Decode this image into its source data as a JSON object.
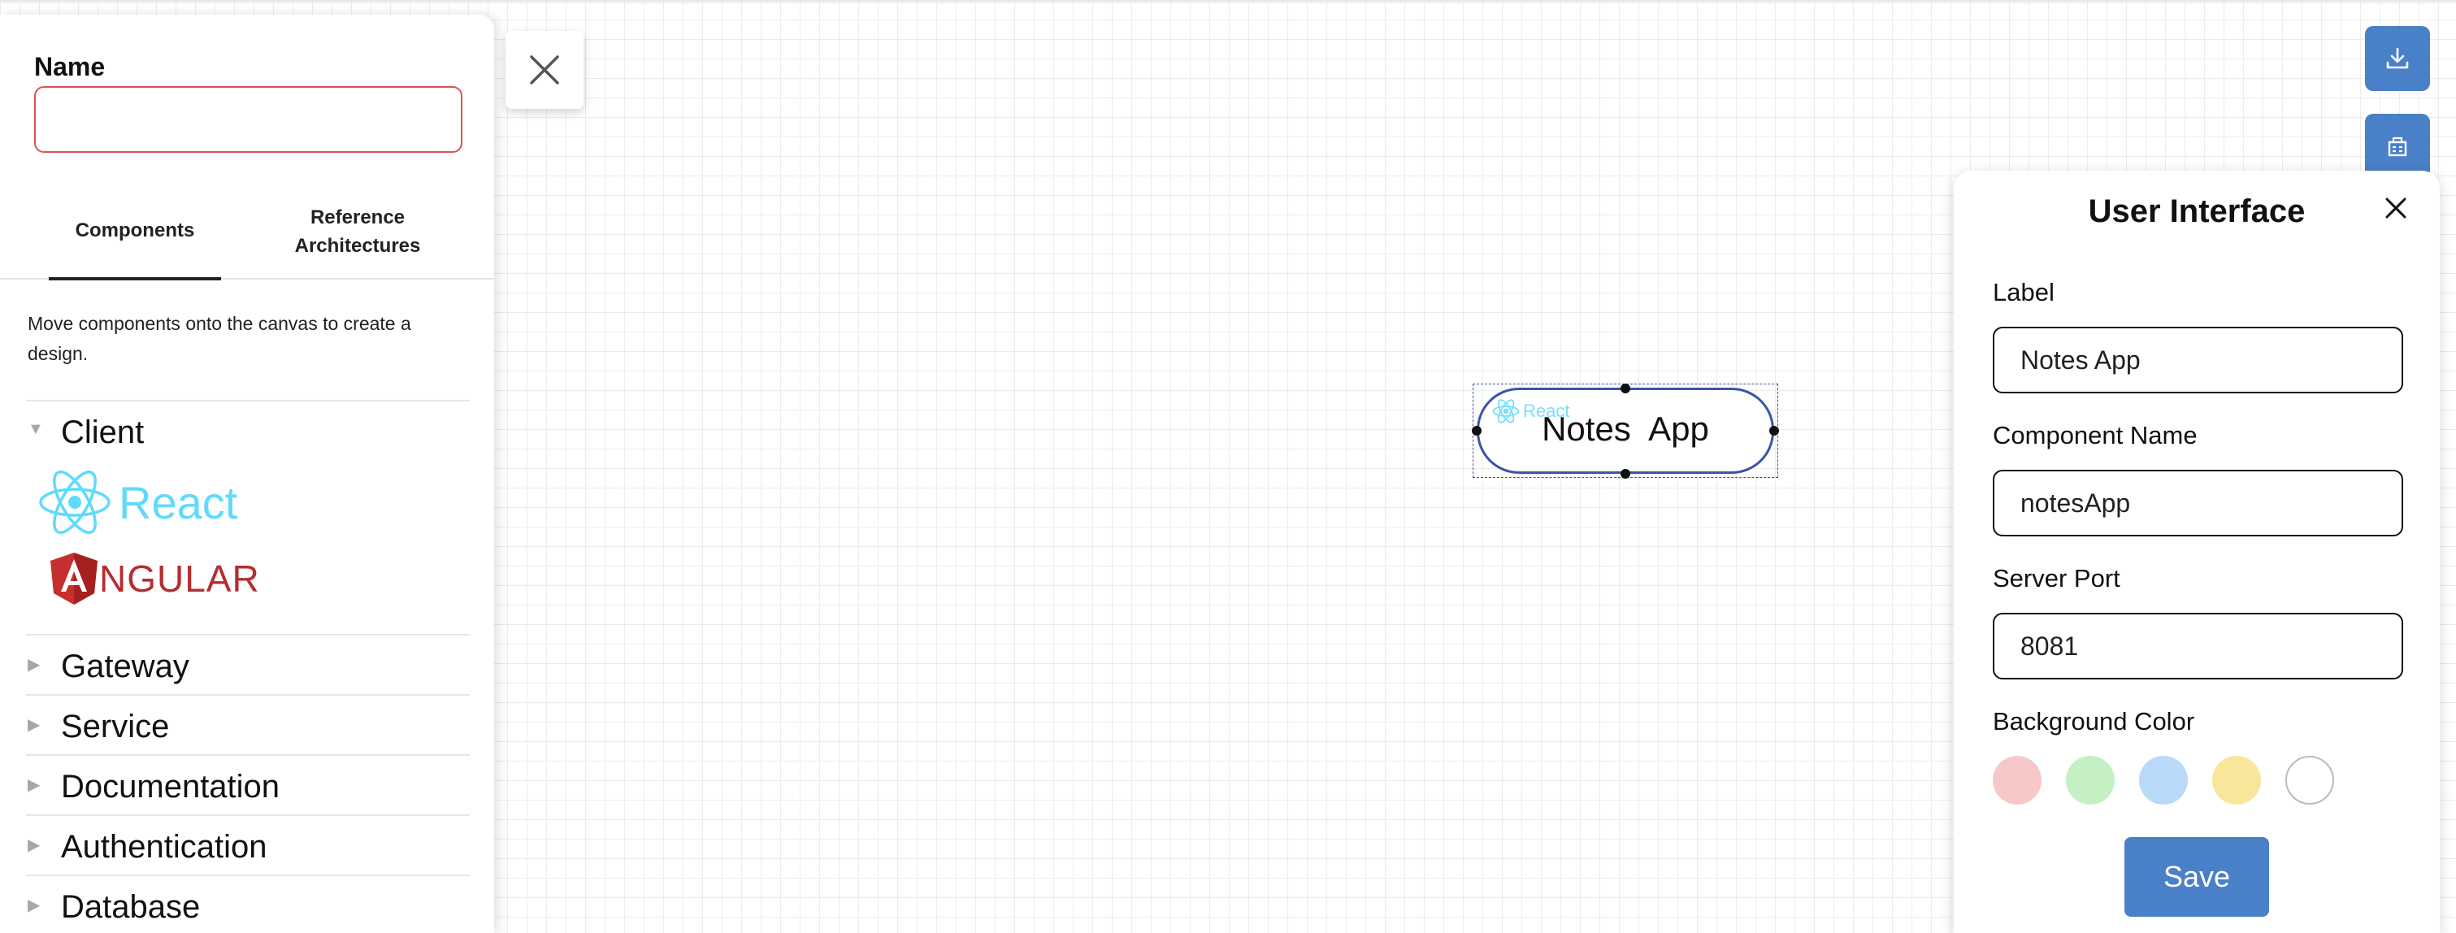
{
  "sidebar": {
    "name_label": "Name",
    "name_value": "",
    "tabs": [
      {
        "label": "Components"
      },
      {
        "label": "Reference Architectures"
      }
    ],
    "help_text": "Move components onto the canvas to create a design.",
    "tree": [
      {
        "label": "Client",
        "expanded": true,
        "items": [
          {
            "name": "React",
            "icon": "react-logo"
          },
          {
            "name": "NGULAR",
            "icon": "angular-logo"
          }
        ]
      },
      {
        "label": "Gateway",
        "expanded": false
      },
      {
        "label": "Service",
        "expanded": false
      },
      {
        "label": "Documentation",
        "expanded": false
      },
      {
        "label": "Authentication",
        "expanded": false
      },
      {
        "label": "Database",
        "expanded": false
      }
    ]
  },
  "canvas": {
    "node": {
      "label": "Notes App",
      "badge": "React",
      "border_color": "#3b55a6"
    }
  },
  "toolbar": {
    "icons": [
      "download-icon",
      "deploy-icon"
    ],
    "button_color": "#4a80c8"
  },
  "properties": {
    "title": "User Interface",
    "label_label": "Label",
    "label_value": "Notes App",
    "component_name_label": "Component Name",
    "component_name_value": "notesApp",
    "server_port_label": "Server Port",
    "server_port_value": "8081",
    "background_color_label": "Background Color",
    "swatches": [
      "#f8c8c8",
      "#c4f0c4",
      "#b8daf8",
      "#f8e69a",
      "#ffffff"
    ],
    "save_label": "Save"
  }
}
